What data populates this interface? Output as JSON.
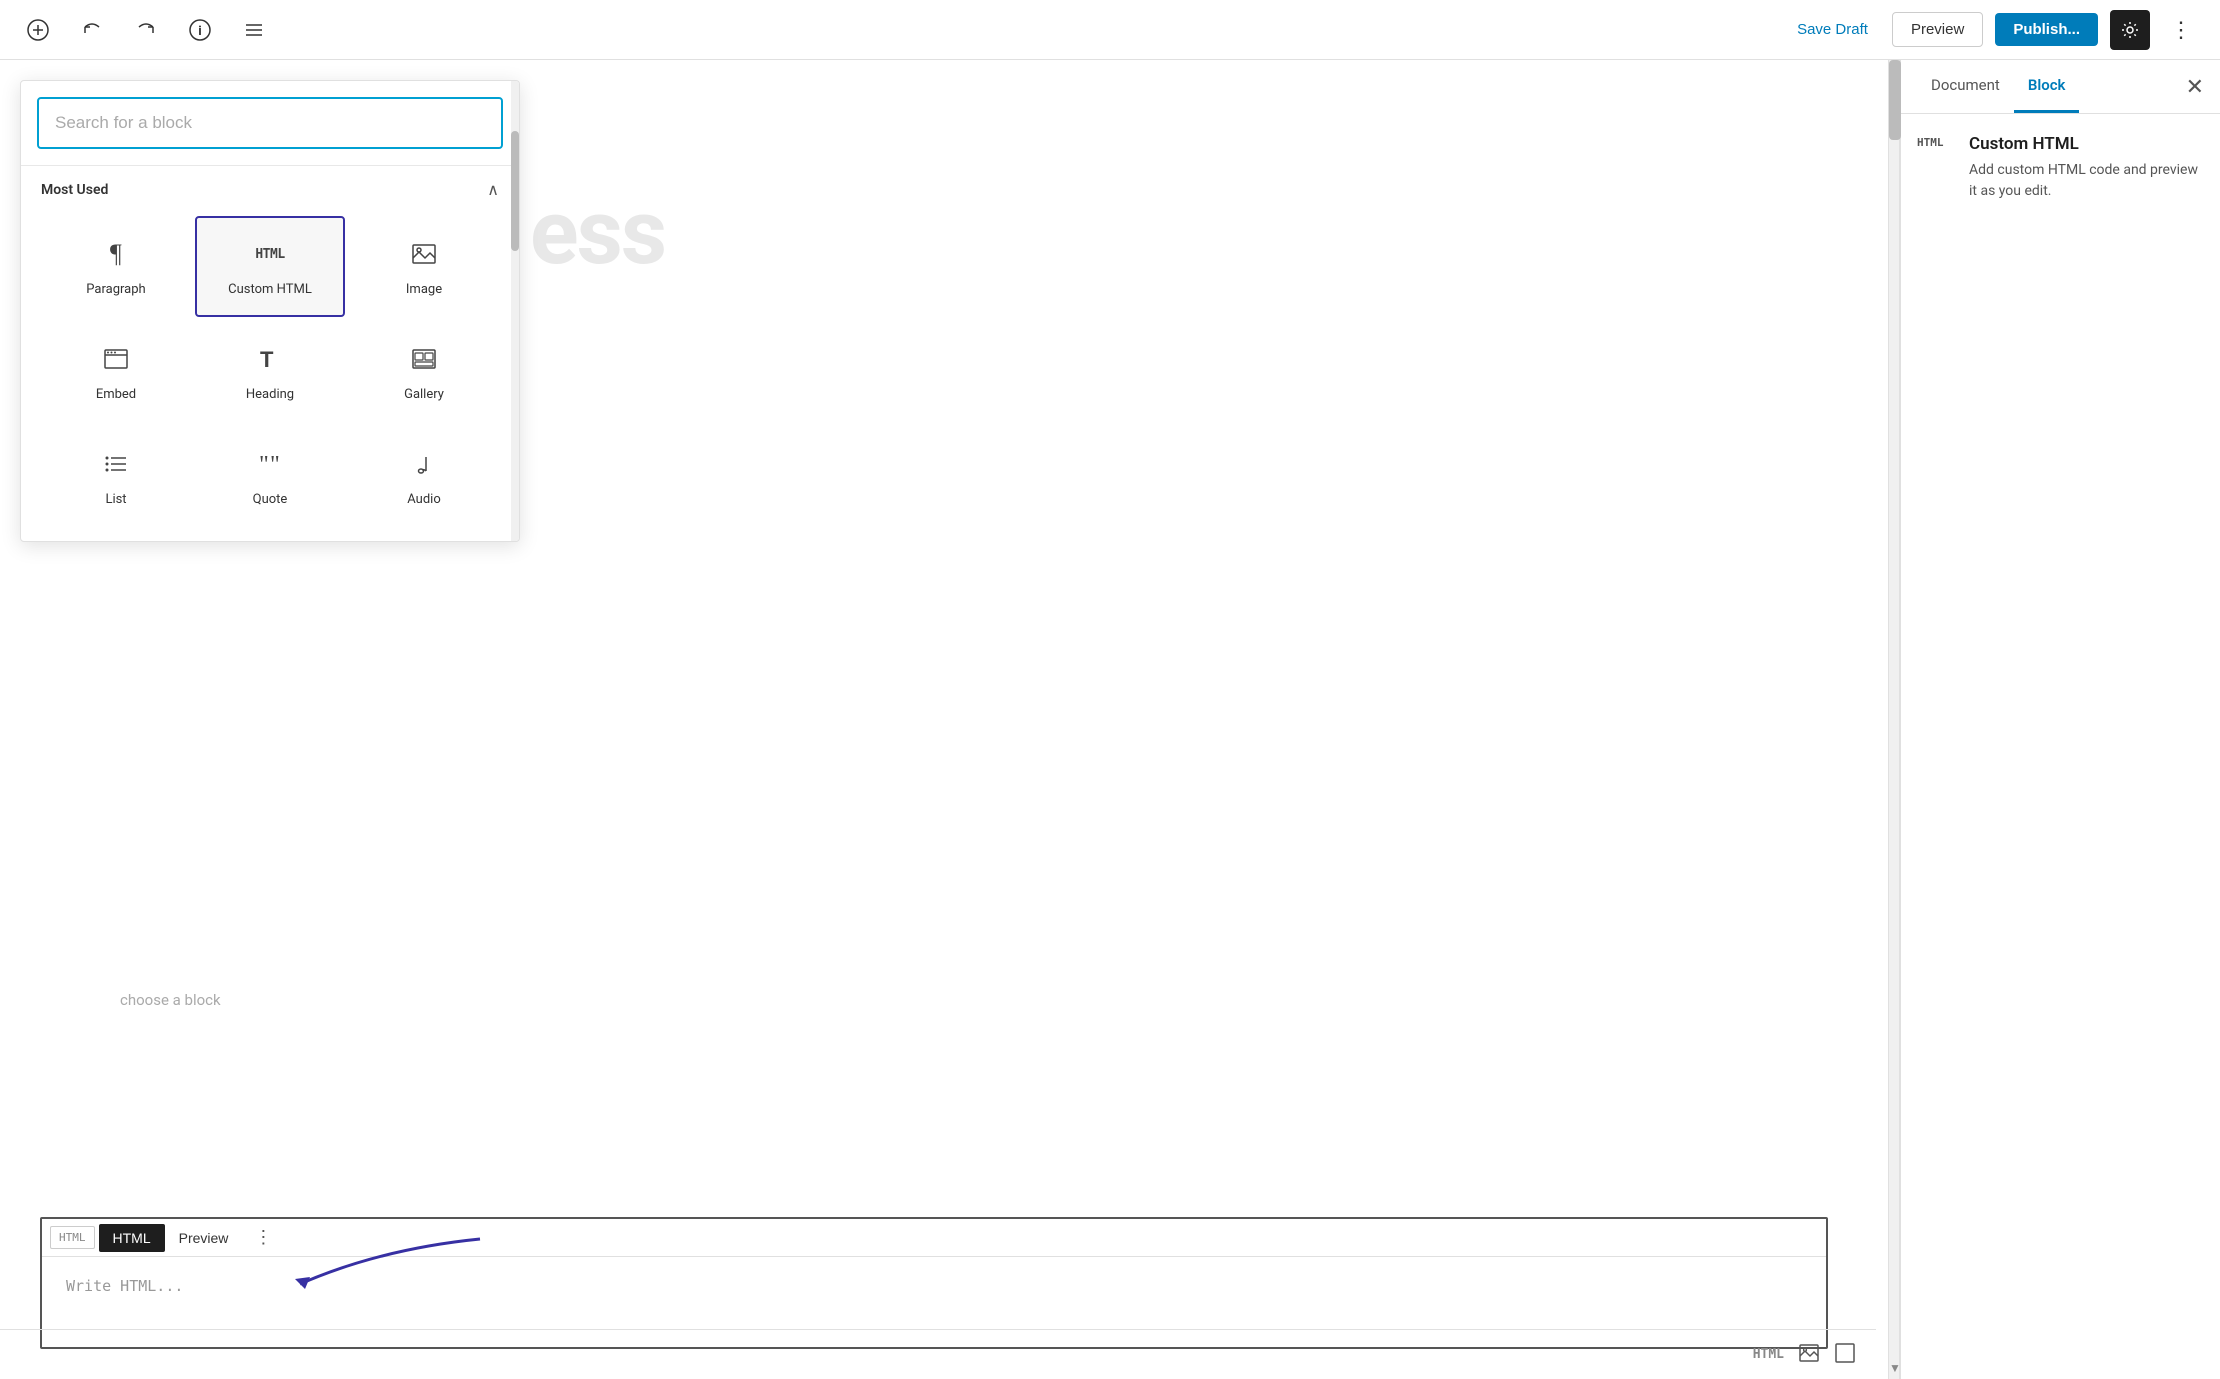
{
  "toolbar": {
    "add_label": "+",
    "undo_label": "↺",
    "redo_label": "↻",
    "info_label": "ℹ",
    "list_label": "☰",
    "save_draft_label": "Save Draft",
    "preview_label": "Preview",
    "publish_label": "Publish...",
    "settings_icon": "⚙",
    "more_icon": "⋮"
  },
  "block_inserter": {
    "search_placeholder": "Search for a block",
    "section_title": "Most Used",
    "collapse_icon": "∧",
    "blocks": [
      {
        "id": "paragraph",
        "label": "Paragraph",
        "icon": "¶"
      },
      {
        "id": "custom-html",
        "label": "Custom HTML",
        "icon": "HTML",
        "selected": true
      },
      {
        "id": "image",
        "label": "Image",
        "icon": "image"
      },
      {
        "id": "embed",
        "label": "Embed",
        "icon": "embed"
      },
      {
        "id": "heading",
        "label": "Heading",
        "icon": "T"
      },
      {
        "id": "gallery",
        "label": "Gallery",
        "icon": "gallery"
      },
      {
        "id": "list",
        "label": "List",
        "icon": "list"
      },
      {
        "id": "quote",
        "label": "Quote",
        "icon": "quote"
      },
      {
        "id": "audio",
        "label": "Audio",
        "icon": "audio"
      }
    ]
  },
  "editor": {
    "bg_text": "ess",
    "choose_block_text": "choose a block"
  },
  "html_block": {
    "tag_label": "HTML",
    "tab_html": "HTML",
    "tab_preview": "Preview",
    "more_icon": "⋮",
    "body_placeholder": "Write HTML..."
  },
  "bottom_toolbar": {
    "html_label": "HTML",
    "image_icon": "⬜",
    "square_icon": "⬜"
  },
  "right_panel": {
    "tab_document": "Document",
    "tab_block": "Block",
    "close_icon": "✕",
    "active_tab": "Block",
    "block_icon": "HTML",
    "block_title": "Custom HTML",
    "block_desc": "Add custom HTML code and preview it as you edit."
  }
}
